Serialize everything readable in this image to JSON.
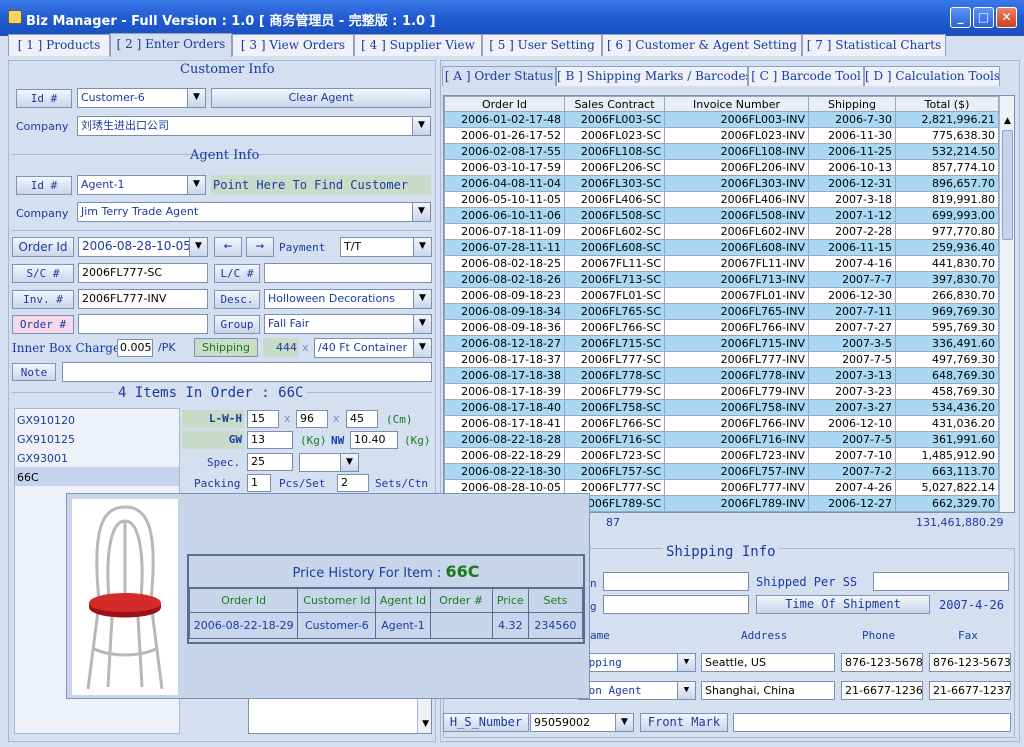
{
  "window": {
    "title": "Biz Manager - Full Version : 1.0    [ 商务管理员 - 完整版 : 1.0 ]"
  },
  "main_tabs": [
    "[ 1 ] Products",
    "[ 2 ] Enter Orders",
    "[ 3 ] View Orders",
    "[ 4 ] Supplier View",
    "[ 5 ] User Setting",
    "[ 6 ] Customer & Agent Setting",
    "[ 7 ] Statistical Charts"
  ],
  "customer_info": {
    "title": "Customer Info",
    "id_label": "Id #",
    "id_value": "Customer-6",
    "clear_label": "Clear Agent",
    "company_label": "Company",
    "company_value": "刘琇生进出口公司"
  },
  "agent_info": {
    "title": "Agent Info",
    "id_label": "Id #",
    "id_value": "Agent-1",
    "find_label": "Point Here To Find Customer",
    "company_label": "Company",
    "company_value": "Jim Terry Trade Agent"
  },
  "order": {
    "order_id_label": "Order Id",
    "order_id_value": "2006-08-28-10-05",
    "payment_label": "Payment",
    "payment_value": "T/T",
    "sc_label": "S/C #",
    "sc_value": "2006FL777-SC",
    "lc_label": "L/C #",
    "lc_value": "",
    "inv_label": "Inv. #",
    "inv_value": "2006FL777-INV",
    "desc_label": "Desc.",
    "desc_value": "Holloween Decorations",
    "order_num_label": "Order #",
    "order_num_value": "",
    "group_label": "Group",
    "group_value": "Fall Fair",
    "inner_box_label": "Inner Box Charge",
    "inner_box_value": "0.005",
    "per_pk": "/PK",
    "shipping_label": "Shipping",
    "shipping_count": "444",
    "x_sign": "x",
    "container_value": "/40 Ft Container",
    "note_label": "Note",
    "note_value": ""
  },
  "items": {
    "header": "4 Items In Order : 66C",
    "list": [
      "GX910120",
      "GX910125",
      "GX93001",
      "66C"
    ],
    "lwh_label": "L-W-H",
    "l": "15",
    "w": "96",
    "h": "45",
    "x_sign": "x",
    "cm_unit": "(Cm)",
    "gw_label": "GW",
    "gw_value": "13",
    "kg_unit": "(Kg)",
    "nw_label": "NW",
    "nw_value": "10.40",
    "spec_label": "Spec.",
    "spec_value": "25",
    "packing_label": "Packing",
    "packing_value": "1",
    "pcs_set_label": "Pcs/Set",
    "sets_value": "2",
    "sets_ctn_label": "Sets/Ctn"
  },
  "price_history": {
    "title_prefix": "Price History For Item :",
    "item": "66C",
    "columns": [
      "Order Id",
      "Customer Id",
      "Agent Id",
      "Order #",
      "Price",
      "Sets"
    ],
    "rows": [
      [
        "2006-08-22-18-29",
        "Customer-6",
        "Agent-1",
        "",
        "4.32",
        "234560"
      ]
    ]
  },
  "sub_tabs": [
    "[ A ] Order Status",
    "[ B ] Shipping Marks / Barcodes",
    "[ C ] Barcode Tool",
    "[ D ] Calculation Tools"
  ],
  "orders_table": {
    "columns": [
      "Order Id",
      "Sales Contract",
      "Invoice Number",
      "Shipping",
      "Total ($)"
    ],
    "rows": [
      [
        "2006-01-02-17-48",
        "2006FL003-SC",
        "2006FL003-INV",
        "2006-7-30",
        "2,821,996.21"
      ],
      [
        "2006-01-26-17-52",
        "2006FL023-SC",
        "2006FL023-INV",
        "2006-11-30",
        "775,638.30"
      ],
      [
        "2006-02-08-17-55",
        "2006FL108-SC",
        "2006FL108-INV",
        "2006-11-25",
        "532,214.50"
      ],
      [
        "2006-03-10-17-59",
        "2006FL206-SC",
        "2006FL206-INV",
        "2006-10-13",
        "857,774.10"
      ],
      [
        "2006-04-08-11-04",
        "2006FL303-SC",
        "2006FL303-INV",
        "2006-12-31",
        "896,657.70"
      ],
      [
        "2006-05-10-11-05",
        "2006FL406-SC",
        "2006FL406-INV",
        "2007-3-18",
        "819,991.80"
      ],
      [
        "2006-06-10-11-06",
        "2006FL508-SC",
        "2006FL508-INV",
        "2007-1-12",
        "699,993.00"
      ],
      [
        "2006-07-18-11-09",
        "2006FL602-SC",
        "2006FL602-INV",
        "2007-2-28",
        "977,770.80"
      ],
      [
        "2006-07-28-11-11",
        "2006FL608-SC",
        "2006FL608-INV",
        "2006-11-15",
        "259,936.40"
      ],
      [
        "2006-08-02-18-25",
        "20067FL11-SC",
        "20067FL11-INV",
        "2007-4-16",
        "441,830.70"
      ],
      [
        "2006-08-02-18-26",
        "2006FL713-SC",
        "2006FL713-INV",
        "2007-7-7",
        "397,830.70"
      ],
      [
        "2006-08-09-18-23",
        "20067FL01-SC",
        "20067FL01-INV",
        "2006-12-30",
        "266,830.70"
      ],
      [
        "2006-08-09-18-34",
        "2006FL765-SC",
        "2006FL765-INV",
        "2007-7-11",
        "969,769.30"
      ],
      [
        "2006-08-09-18-36",
        "2006FL766-SC",
        "2006FL766-INV",
        "2007-7-27",
        "595,769.30"
      ],
      [
        "2006-08-12-18-27",
        "2006FL715-SC",
        "2006FL715-INV",
        "2007-3-5",
        "336,491.60"
      ],
      [
        "2006-08-17-18-37",
        "2006FL777-SC",
        "2006FL777-INV",
        "2007-7-5",
        "497,769.30"
      ],
      [
        "2006-08-17-18-38",
        "2006FL778-SC",
        "2006FL778-INV",
        "2007-3-13",
        "648,769.30"
      ],
      [
        "2006-08-17-18-39",
        "2006FL779-SC",
        "2006FL779-INV",
        "2007-3-23",
        "458,769.30"
      ],
      [
        "2006-08-17-18-40",
        "2006FL758-SC",
        "2006FL758-INV",
        "2007-3-27",
        "534,436.20"
      ],
      [
        "2006-08-17-18-41",
        "2006FL766-SC",
        "2006FL766-INV",
        "2006-12-10",
        "431,036.20"
      ],
      [
        "2006-08-22-18-28",
        "2006FL716-SC",
        "2006FL716-INV",
        "2007-7-5",
        "361,991.60"
      ],
      [
        "2006-08-22-18-29",
        "2006FL723-SC",
        "2006FL723-INV",
        "2007-7-10",
        "1,485,912.90"
      ],
      [
        "2006-08-22-18-30",
        "2006FL757-SC",
        "2006FL757-INV",
        "2007-7-2",
        "663,113.70"
      ],
      [
        "2006-08-28-10-05",
        "2006FL777-SC",
        "2006FL777-INV",
        "2007-4-26",
        "5,027,822.14"
      ],
      [
        "2006-08-28-10-05",
        "2006FL789-SC",
        "2006FL789-INV",
        "2006-12-27",
        "662,329.70"
      ]
    ],
    "row_count": "87",
    "grand_total": "131,461,880.29"
  },
  "shipping_info": {
    "title": "Shipping Info",
    "label_n_tail": "n",
    "label_g_tail": "g",
    "shipped_per_ss_label": "Shipped Per SS",
    "shipped_per_ss_value": "",
    "time_of_shipment_label": "Time Of Shipment",
    "time_of_shipment_value": "2007-4-26",
    "col_name": "ame",
    "col_address": "Address",
    "col_phone": "Phone",
    "col_fax": "Fax",
    "rows": [
      {
        "name": "ipping",
        "address": "Seattle, US",
        "phone": "876-123-5678",
        "fax": "876-123-5673"
      },
      {
        "name": "oon Agent",
        "address": "Shanghai, China",
        "phone": "21-6677-1236",
        "fax": "21-6677-1237"
      }
    ],
    "hs_label": "H_S_Number",
    "hs_value": "95059002",
    "front_mark_label": "Front Mark",
    "front_mark_value": ""
  },
  "colors": {
    "highlight_row": "#a8d8f4",
    "accent_blue": "#1a3aa0",
    "accent_green": "#1a7a1a",
    "title_bar": "#1f5ad0"
  }
}
